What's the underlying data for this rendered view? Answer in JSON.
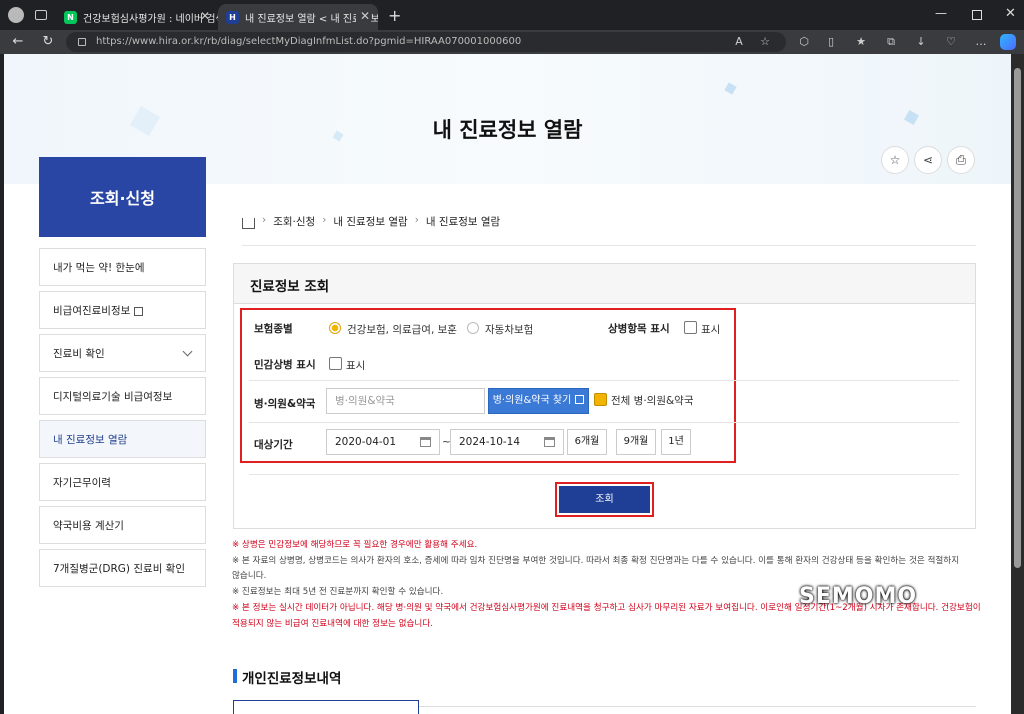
{
  "browser": {
    "tabs": [
      {
        "label": "건강보험심사평가원 : 네이버 검색",
        "favicon": "N",
        "active": false
      },
      {
        "label": "내 진료정보 열람 < 내 진료정보 열람",
        "favicon": "H",
        "active": true
      }
    ],
    "url": "https://www.hira.or.kr/rb/diag/selectMyDiagInfmList.do?pgmid=HIRAA070001000600"
  },
  "page": {
    "title": "내 진료정보 열람",
    "header_icons": [
      "star-icon",
      "share-icon",
      "print-icon"
    ]
  },
  "sidebar": {
    "header": "조회·신청",
    "items": [
      {
        "label": "내가 먹는 약! 한눈에"
      },
      {
        "label": "비급여진료비정보"
      },
      {
        "label": "진료비 확인"
      },
      {
        "label": "디지털의료기술 비급여정보"
      },
      {
        "label": "내 진료정보 열람"
      },
      {
        "label": "자기근무이력"
      },
      {
        "label": "약국비용 계산기"
      },
      {
        "label": "7개질병군(DRG) 진료비 확인"
      }
    ]
  },
  "breadcrumb": [
    "조회·신청",
    "내 진료정보 열람",
    "내 진료정보 열람"
  ],
  "form": {
    "section_title": "진료정보 조회",
    "insurance_label": "보험종별",
    "insurance_option_1": "건강보험, 의료급여, 보훈",
    "insurance_option_2": "자동차보험",
    "disease_display_label": "상병항목 표시",
    "display_text": "표시",
    "sensitive_label": "민감상병 표시",
    "sensitive_display_text": "표시",
    "hospital_label": "병·의원&약국",
    "hospital_placeholder": "병·의원&약국",
    "hospital_search_button": "병·의원&약국 찾기",
    "all_hospitals_label": "전체 병·의원&약국",
    "period_label": "대상기간",
    "start_date": "2020-04-01",
    "tilde": "~",
    "end_date": "2024-10-14",
    "period_6m": "6개월",
    "period_9m": "9개월",
    "period_1y": "1년",
    "query_button": "조회"
  },
  "notes": [
    "※ 상병은 민감정보에 해당하므로 꼭 필요한 경우에만 활용해 주세요.",
    "※ 본 자료의 상병명, 상병코드는 의사가 환자의 호소, 증세에 따라 임차 진단명을 부여한 것입니다. 따라서 최종 확정 진단명과는 다를 수 있습니다. 이를 통해 환자의 건강상태 등을 확인하는 것은 적절하지",
    "않습니다.",
    "※ 진료정보는 최대 5년 전 진료분까지 확인할 수 있습니다.",
    "※ 본 정보는 실시간 데이터가 아닙니다. 해당 병·의원 및 약국에서 건강보험심사평가원에 진료내역을 청구하고 심사가 마무리된 자료가 보여집니다. 이로인해 일정기간(1~2개월) 시차가 존재합니다. 건강보험이",
    "적용되지 않는 비급여 진료내역에 대한 정보는 없습니다."
  ],
  "results_section_title": "개인진료정보내역",
  "watermark": "SEMOMO",
  "colors": {
    "accent": "#1e3f95",
    "highlight": "#e02020",
    "warning": "#d0021b",
    "checkbox": "#f3b400"
  }
}
